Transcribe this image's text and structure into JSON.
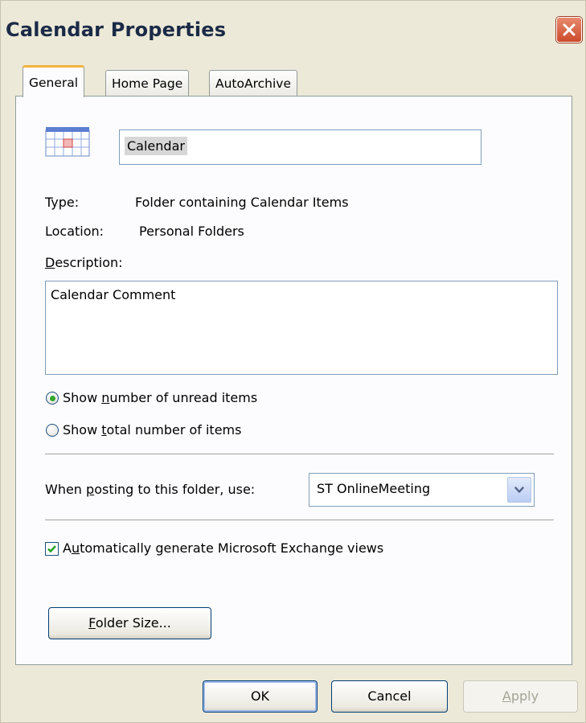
{
  "window": {
    "title": "Calendar Properties"
  },
  "tabs": [
    "General",
    "Home Page",
    "AutoArchive"
  ],
  "general": {
    "folder_name": "Calendar",
    "type_label": "Type:",
    "type_value": "Folder containing Calendar Items",
    "location_label": "Location:",
    "location_value": "Personal Folders",
    "description_label": {
      "pre": "",
      "key": "D",
      "post": "escription:"
    },
    "description_value": "Calendar Comment",
    "radio_unread": {
      "pre": "Show ",
      "key": "n",
      "post": "umber of unread items",
      "selected": true
    },
    "radio_total": {
      "pre": "Show ",
      "key": "t",
      "post": "otal number of items",
      "selected": false
    },
    "posting_label": {
      "pre": "When ",
      "key": "p",
      "post": "osting to this folder, use:"
    },
    "posting_value": "ST OnlineMeeting",
    "auto_views": {
      "pre": "A",
      "key": "u",
      "post": "tomatically generate Microsoft Exchange views",
      "checked": true
    },
    "folder_size_button": {
      "pre": "",
      "key": "F",
      "post": "older Size..."
    }
  },
  "buttons": {
    "ok": "OK",
    "cancel": "Cancel",
    "apply": {
      "pre": "",
      "key": "A",
      "post": "pply"
    }
  },
  "icons": [
    "close-icon",
    "calendar-folder-icon",
    "chevron-down-icon",
    "checkmark-icon"
  ],
  "colors": {
    "tab_accent": "#f2b33d",
    "radio_dot": "#31a52d",
    "close_red": "#cc4a2a",
    "panel_bg": "#fcfcfe",
    "window_bg": "#ece9d8"
  }
}
